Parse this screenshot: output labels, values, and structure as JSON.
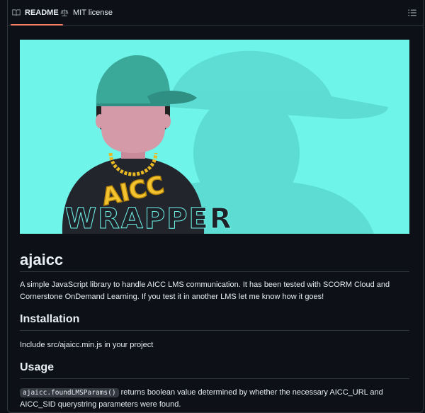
{
  "tabs": [
    {
      "label": "README",
      "icon": "book-icon",
      "active": true
    },
    {
      "label": "MIT license",
      "icon": "law-icon",
      "active": false
    }
  ],
  "outline_icon": "list-unordered-icon",
  "hero": {
    "badge_text": "AICC",
    "wordmark": "WRAPPER",
    "colors": {
      "background": "#6ff4ea",
      "cap": "#3aa99a",
      "face": "#d49aa8",
      "shirt": "#23252c",
      "chain": "#e8b923"
    }
  },
  "readme": {
    "title": "ajaicc",
    "intro": "A simple JavaScript library to handle AICC LMS communication. It has been tested with SCORM Cloud and Cornerstone OnDemand Learning. If you test it in another LMS let me know how it goes!",
    "installation_heading": "Installation",
    "installation_text": "Include src/ajaicc.min.js in your project",
    "usage_heading": "Usage",
    "usage_code": "ajaicc.foundLMSParams()",
    "usage_text": "returns boolean value determined by whether the necessary AICC_URL and AICC_SID querystring parameters were found."
  }
}
